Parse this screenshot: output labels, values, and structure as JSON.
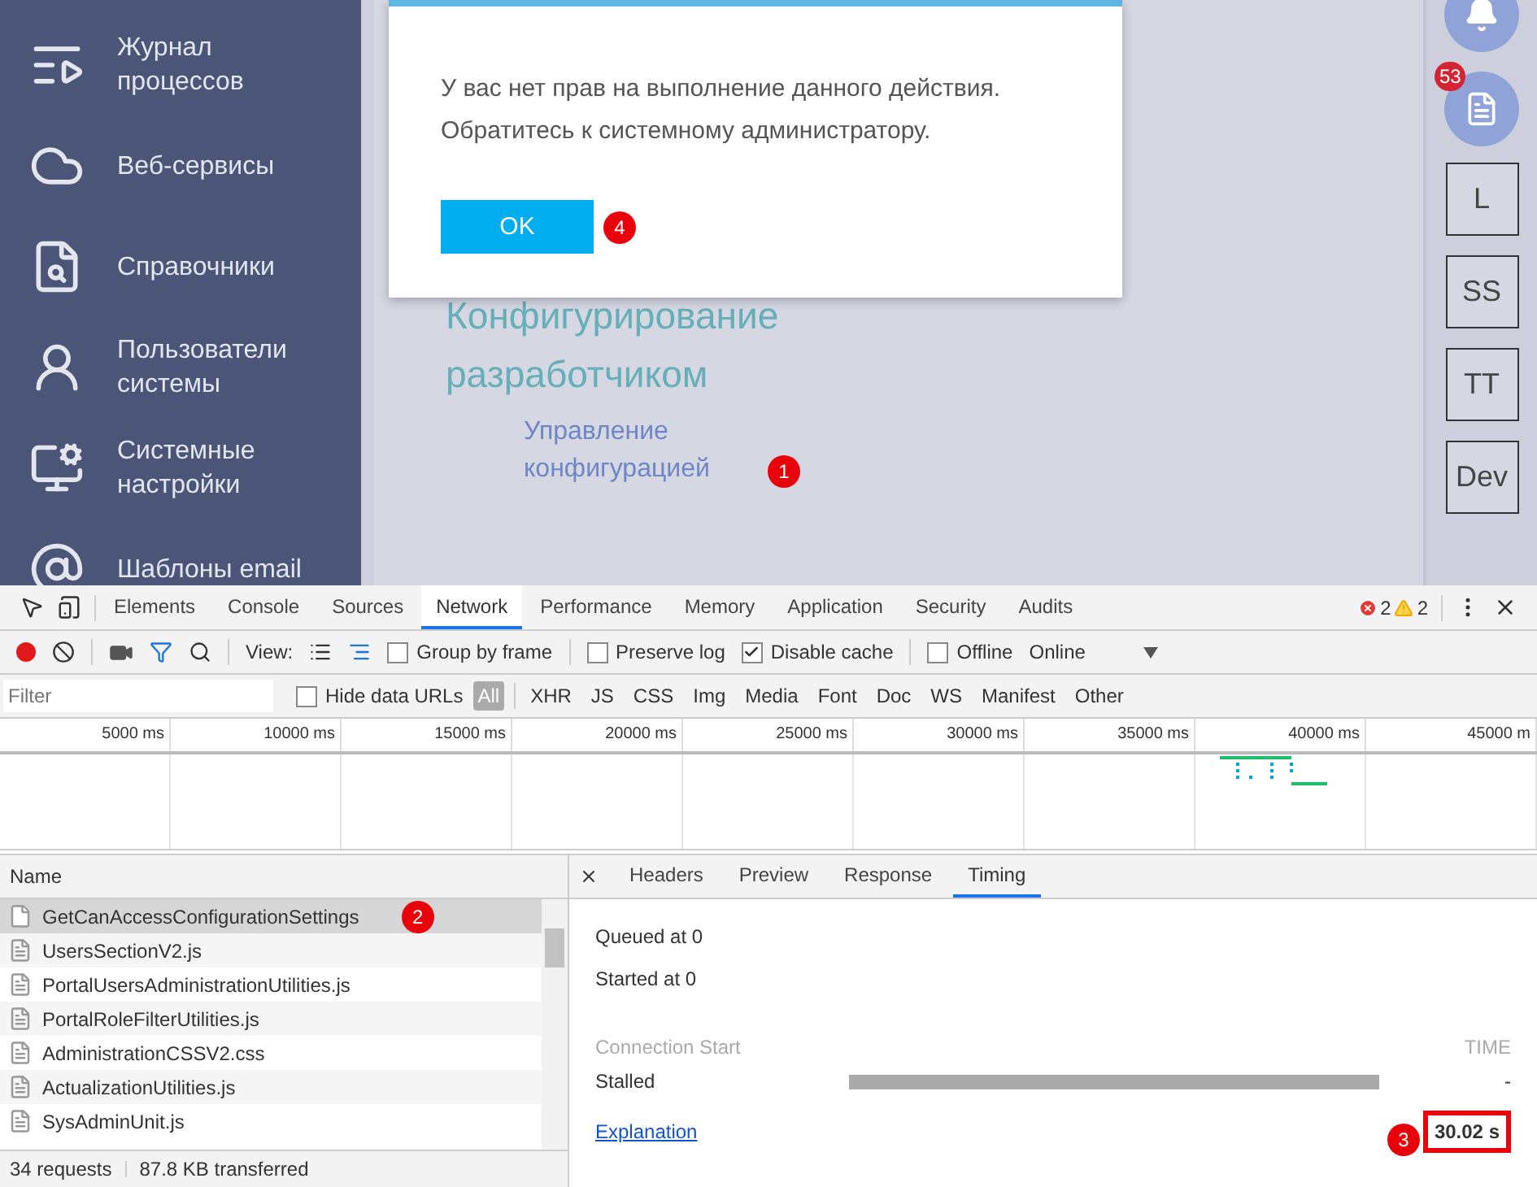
{
  "sidebar": {
    "items": [
      {
        "label": "Журнал процессов"
      },
      {
        "label": "Веб-сервисы"
      },
      {
        "label": "Справочники"
      },
      {
        "label": "Пользователи системы"
      },
      {
        "label": "Системные настройки"
      },
      {
        "label": "Шаблоны email"
      }
    ]
  },
  "content": {
    "heading": "Конфигурирование разработчиком",
    "link": "Управление конфигурацией",
    "link_marker": "1"
  },
  "dialog": {
    "message": "У вас нет прав на выполнение данного действия. Обратитесь к системному администратору.",
    "button": "OK",
    "button_marker": "4"
  },
  "right_panel": {
    "notifications_badge": "53",
    "buttons": [
      "L",
      "SS",
      "TT",
      "Dev"
    ]
  },
  "devtools": {
    "tabs": [
      {
        "label": "Elements",
        "selected": false
      },
      {
        "label": "Console",
        "selected": false
      },
      {
        "label": "Sources",
        "selected": false
      },
      {
        "label": "Network",
        "selected": true
      },
      {
        "label": "Performance",
        "selected": false
      },
      {
        "label": "Memory",
        "selected": false
      },
      {
        "label": "Application",
        "selected": false
      },
      {
        "label": "Security",
        "selected": false
      },
      {
        "label": "Audits",
        "selected": false
      }
    ],
    "errors": "2",
    "warnings": "2",
    "toolbar": {
      "recording": true,
      "filter_active": true,
      "view_label": "View:",
      "options": [
        {
          "label": "Group by frame",
          "checked": false
        },
        {
          "label": "Preserve log",
          "checked": false
        },
        {
          "label": "Disable cache",
          "checked": true
        },
        {
          "label": "Offline",
          "checked": false
        }
      ],
      "throttling": "Online"
    },
    "filter": {
      "placeholder": "Filter",
      "hide_data_urls": {
        "label": "Hide data URLs",
        "checked": false
      },
      "types": [
        {
          "label": "All",
          "selected": true
        },
        {
          "label": "XHR",
          "selected": false
        },
        {
          "label": "JS",
          "selected": false
        },
        {
          "label": "CSS",
          "selected": false
        },
        {
          "label": "Img",
          "selected": false
        },
        {
          "label": "Media",
          "selected": false
        },
        {
          "label": "Font",
          "selected": false
        },
        {
          "label": "Doc",
          "selected": false
        },
        {
          "label": "WS",
          "selected": false
        },
        {
          "label": "Manifest",
          "selected": false
        },
        {
          "label": "Other",
          "selected": false
        }
      ]
    },
    "timeline": {
      "ticks": [
        "5000 ms",
        "10000 ms",
        "15000 ms",
        "20000 ms",
        "25000 ms",
        "30000 ms",
        "35000 ms",
        "40000 ms",
        "45000 m"
      ]
    },
    "requests": {
      "column": "Name",
      "rows": [
        {
          "name": "GetCanAccessConfigurationSettings",
          "kind": "xhr",
          "selected": true,
          "marker": "2"
        },
        {
          "name": "UsersSectionV2.js",
          "kind": "script",
          "selected": false
        },
        {
          "name": "PortalUsersAdministrationUtilities.js",
          "kind": "script",
          "selected": false
        },
        {
          "name": "PortalRoleFilterUtilities.js",
          "kind": "script",
          "selected": false
        },
        {
          "name": "AdministrationCSSV2.css",
          "kind": "script",
          "selected": false
        },
        {
          "name": "ActualizationUtilities.js",
          "kind": "script",
          "selected": false
        },
        {
          "name": "SysAdminUnit.js",
          "kind": "script",
          "selected": false
        }
      ],
      "summary": [
        "34 requests",
        "87.8 KB transferred"
      ]
    },
    "details": {
      "tabs": [
        {
          "label": "Headers",
          "selected": false
        },
        {
          "label": "Preview",
          "selected": false
        },
        {
          "label": "Response",
          "selected": false
        },
        {
          "label": "Timing",
          "selected": true
        }
      ],
      "queued": "Queued at 0",
      "started": "Started at 0",
      "section": "Connection Start",
      "time_header": "TIME",
      "phases": [
        {
          "label": "Stalled",
          "value": "-"
        }
      ],
      "explanation": "Explanation",
      "total": "30.02 s",
      "total_highlighted": true,
      "total_marker": "3"
    }
  }
}
